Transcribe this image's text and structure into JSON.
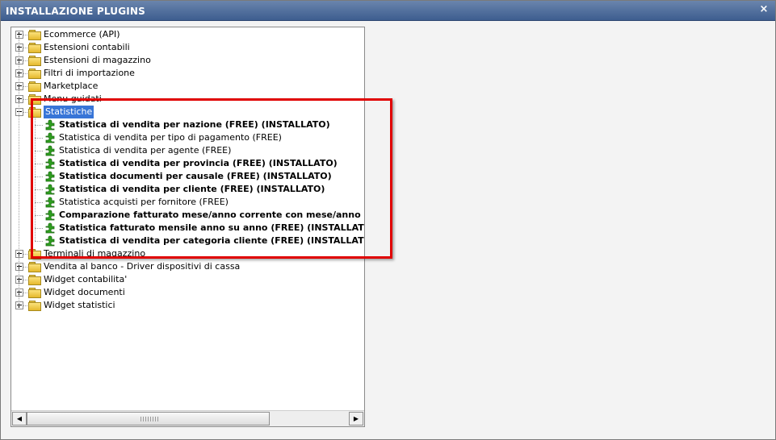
{
  "window": {
    "title": "INSTALLAZIONE PLUGINS",
    "close_symbol": "×"
  },
  "tree": {
    "top_before": [
      {
        "label": "Ecommerce (API)",
        "expanded": false
      },
      {
        "label": "Estensioni contabili",
        "expanded": false
      },
      {
        "label": "Estensioni di magazzino",
        "expanded": false
      },
      {
        "label": "Filtri di importazione",
        "expanded": false
      },
      {
        "label": "Marketplace",
        "expanded": false
      },
      {
        "label": "Menu guidati",
        "expanded": false
      }
    ],
    "selected_folder": {
      "label": "Statistiche",
      "expanded": true,
      "selected": true
    },
    "children": [
      {
        "label": "Statistica di vendita per nazione (FREE) (INSTALLATO)",
        "installed": true
      },
      {
        "label": "Statistica di vendita per tipo di pagamento (FREE)",
        "installed": false
      },
      {
        "label": "Statistica di vendita per agente (FREE)",
        "installed": false
      },
      {
        "label": "Statistica di vendita per provincia (FREE) (INSTALLATO)",
        "installed": true
      },
      {
        "label": "Statistica documenti per causale (FREE) (INSTALLATO)",
        "installed": true
      },
      {
        "label": "Statistica di vendita per cliente (FREE) (INSTALLATO)",
        "installed": true
      },
      {
        "label": "Statistica acquisti per fornitore (FREE)",
        "installed": false
      },
      {
        "label": "Comparazione fatturato mese/anno corrente con mese/anno pass",
        "installed": true
      },
      {
        "label": "Statistica fatturato mensile anno su anno (FREE) (INSTALLATO)",
        "installed": true
      },
      {
        "label": "Statistica di vendita per categoria cliente (FREE) (INSTALLATO)",
        "installed": true
      }
    ],
    "top_after": [
      {
        "label": "Terminali di magazzino",
        "expanded": false
      },
      {
        "label": "Vendita al banco - Driver dispositivi di cassa",
        "expanded": false
      },
      {
        "label": "Widget contabilita'",
        "expanded": false
      },
      {
        "label": "Widget documenti",
        "expanded": false
      },
      {
        "label": "Widget statistici",
        "expanded": false
      }
    ]
  },
  "scrollbar": {
    "left_arrow": "◀",
    "right_arrow": "▶"
  },
  "colors": {
    "titlebar": "#3d5d8f",
    "highlight_box": "#e00000",
    "selection": "#3875d7",
    "plugin_icon": "#2e9e1f"
  }
}
